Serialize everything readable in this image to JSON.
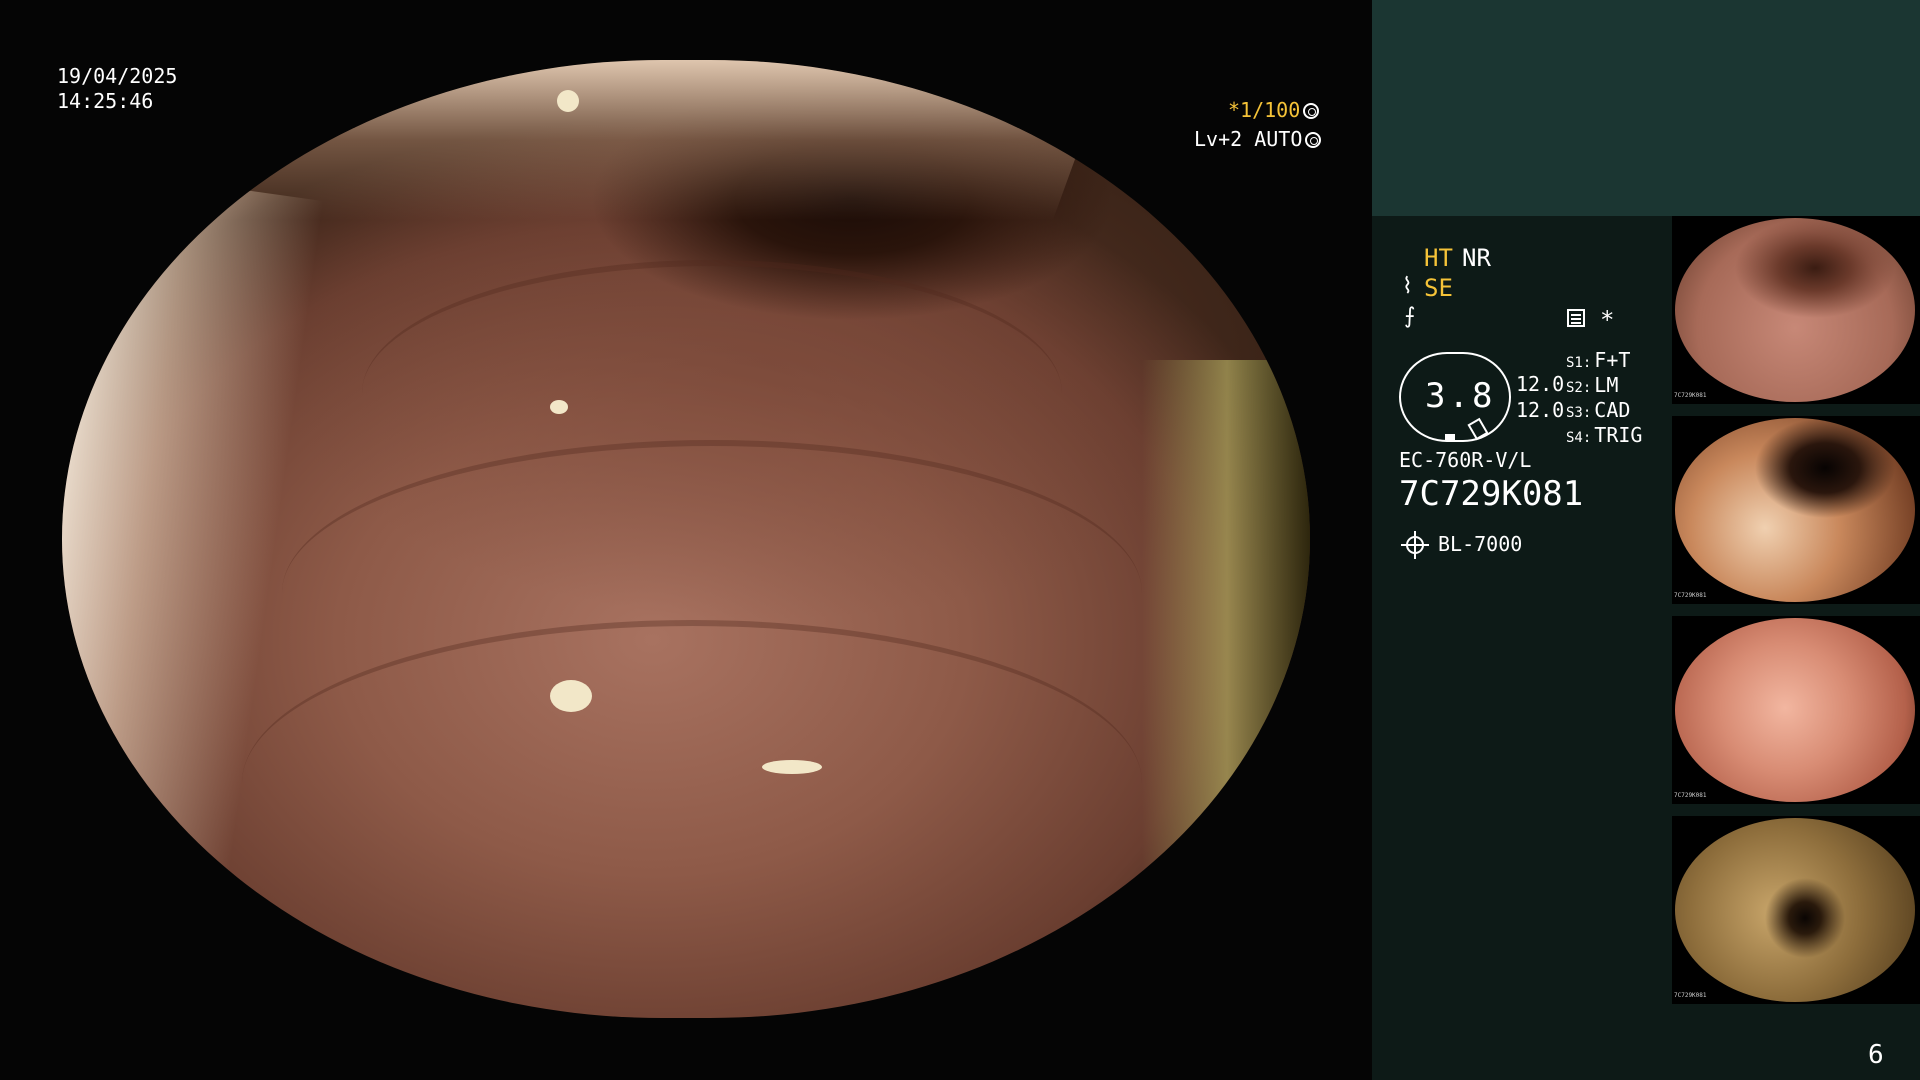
{
  "main_view": {
    "date": "19/04/2025",
    "time": "14:25:46",
    "shutter": "*1/100",
    "level": "Lv+2 AUTO"
  },
  "info_panel": {
    "mode_ht": "HT",
    "mode_nr": "NR",
    "mode_se": "SE",
    "star": "*",
    "zoom_value": "3.8",
    "val_a": "12.0",
    "val_b": "12.0",
    "s_buttons": [
      {
        "key": "S1:",
        "value": "F+T"
      },
      {
        "key": "S2:",
        "value": "LM"
      },
      {
        "key": "S3:",
        "value": "CAD"
      },
      {
        "key": "S4:",
        "value": "TRIG"
      }
    ],
    "scope_model": "EC-760R-V/L",
    "scope_serial": "7C729K081",
    "light_source": "BL-7000",
    "page_number": "6"
  },
  "thumbnails": [
    {
      "serial": "7C729K081"
    },
    {
      "serial": "7C729K081"
    },
    {
      "serial": "7C729K081"
    },
    {
      "serial": "7C729K081"
    }
  ]
}
